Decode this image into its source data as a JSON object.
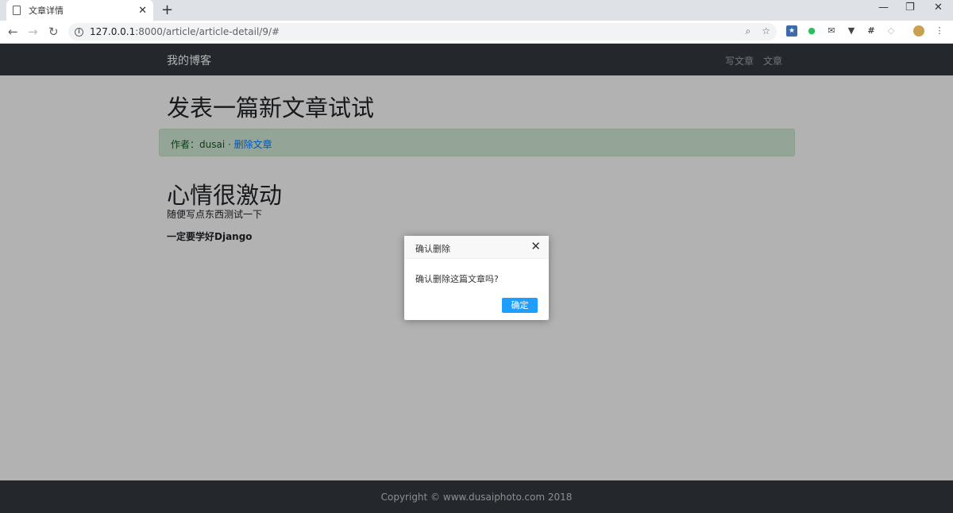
{
  "browser": {
    "tab_title": "文章详情",
    "tab_close": "✕",
    "new_tab": "+",
    "url_host": "127.0.0.1",
    "url_path": ":8000/article/article-detail/9/#",
    "win_min": "—",
    "win_restore": "❐",
    "win_close": "✕"
  },
  "navbar": {
    "brand": "我的博客",
    "links": [
      "写文章",
      "文章"
    ]
  },
  "article": {
    "title": "发表一篇新文章试试",
    "meta_author_label": "作者：dusai · ",
    "meta_delete_link": "删除文章",
    "heading": "心情很激动",
    "para1": "随便写点东西测试一下",
    "para2": "一定要学好Django"
  },
  "footer": {
    "copyright": "Copyright © www.dusaiphoto.com 2018"
  },
  "dialog": {
    "title": "确认删除",
    "message": "确认删除这篇文章吗?",
    "confirm_label": "确定",
    "close": "✕"
  },
  "icons": {
    "back": "←",
    "forward": "→",
    "reload": "↻",
    "info": "i",
    "zoom": "⌕",
    "star": "☆",
    "menu": "⋮"
  }
}
